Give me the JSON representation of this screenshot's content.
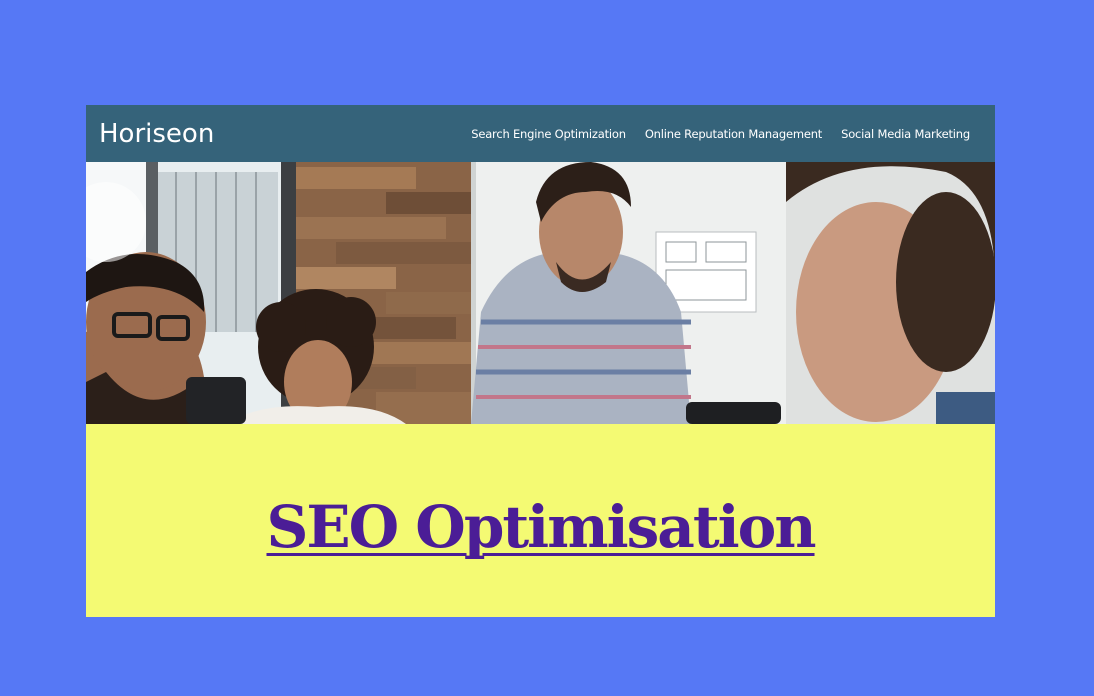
{
  "header": {
    "brand": "Horiseon",
    "nav": [
      {
        "label": "Search Engine Optimization"
      },
      {
        "label": "Online Reputation Management"
      },
      {
        "label": "Social Media Marketing"
      }
    ]
  },
  "hero": {
    "image": "team-meeting-photo"
  },
  "main": {
    "title": "SEO Optimisation"
  },
  "colors": {
    "page_background": "#5678f5",
    "header_background": "#35637a",
    "content_background": "#f4fa73",
    "title_color": "#4b1d96"
  }
}
